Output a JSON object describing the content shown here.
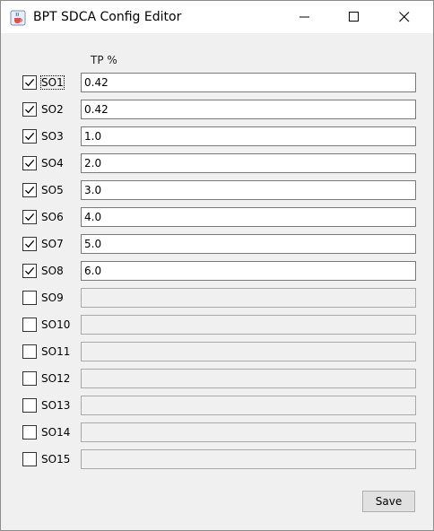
{
  "window": {
    "title": "BPT SDCA Config Editor",
    "icon": "java-cup-icon",
    "controls": {
      "minimize": "minimize-icon",
      "maximize": "maximize-icon",
      "close": "close-icon"
    }
  },
  "table": {
    "column_header": "TP %",
    "rows": [
      {
        "label": "SO1",
        "checked": true,
        "value": "0.42",
        "enabled": true,
        "focused": true
      },
      {
        "label": "SO2",
        "checked": true,
        "value": "0.42",
        "enabled": true
      },
      {
        "label": "SO3",
        "checked": true,
        "value": "1.0",
        "enabled": true
      },
      {
        "label": "SO4",
        "checked": true,
        "value": "2.0",
        "enabled": true
      },
      {
        "label": "SO5",
        "checked": true,
        "value": "3.0",
        "enabled": true
      },
      {
        "label": "SO6",
        "checked": true,
        "value": "4.0",
        "enabled": true
      },
      {
        "label": "SO7",
        "checked": true,
        "value": "5.0",
        "enabled": true
      },
      {
        "label": "SO8",
        "checked": true,
        "value": "6.0",
        "enabled": true
      },
      {
        "label": "SO9",
        "checked": false,
        "value": "",
        "enabled": false
      },
      {
        "label": "SO10",
        "checked": false,
        "value": "",
        "enabled": false
      },
      {
        "label": "SO11",
        "checked": false,
        "value": "",
        "enabled": false
      },
      {
        "label": "SO12",
        "checked": false,
        "value": "",
        "enabled": false
      },
      {
        "label": "SO13",
        "checked": false,
        "value": "",
        "enabled": false
      },
      {
        "label": "SO14",
        "checked": false,
        "value": "",
        "enabled": false
      },
      {
        "label": "SO15",
        "checked": false,
        "value": "",
        "enabled": false
      }
    ]
  },
  "actions": {
    "save_label": "Save"
  },
  "colors": {
    "background": "#f0f0f0",
    "titlebar": "#ffffff",
    "field": "#ffffff",
    "disabled_field": "#f0f0f0",
    "button": "#e1e1e1"
  }
}
